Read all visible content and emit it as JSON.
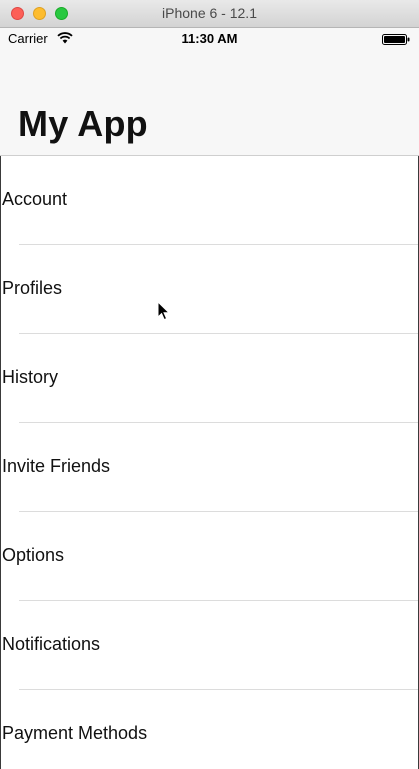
{
  "window": {
    "title": "iPhone 6 - 12.1"
  },
  "status_bar": {
    "carrier": "Carrier",
    "time": "11:30 AM",
    "icons": [
      "wifi-icon",
      "battery-icon"
    ]
  },
  "nav": {
    "title": "My App"
  },
  "menu": {
    "items": [
      {
        "label": "Account"
      },
      {
        "label": "Profiles"
      },
      {
        "label": "History"
      },
      {
        "label": "Invite Friends"
      },
      {
        "label": "Options"
      },
      {
        "label": "Notifications"
      },
      {
        "label": "Payment Methods"
      }
    ]
  },
  "colors": {
    "close": "#fc5f57",
    "minimize": "#fdbc2e",
    "maximize": "#28c840",
    "nav_background": "#f7f7f7",
    "separator": "#dcdcdc"
  }
}
